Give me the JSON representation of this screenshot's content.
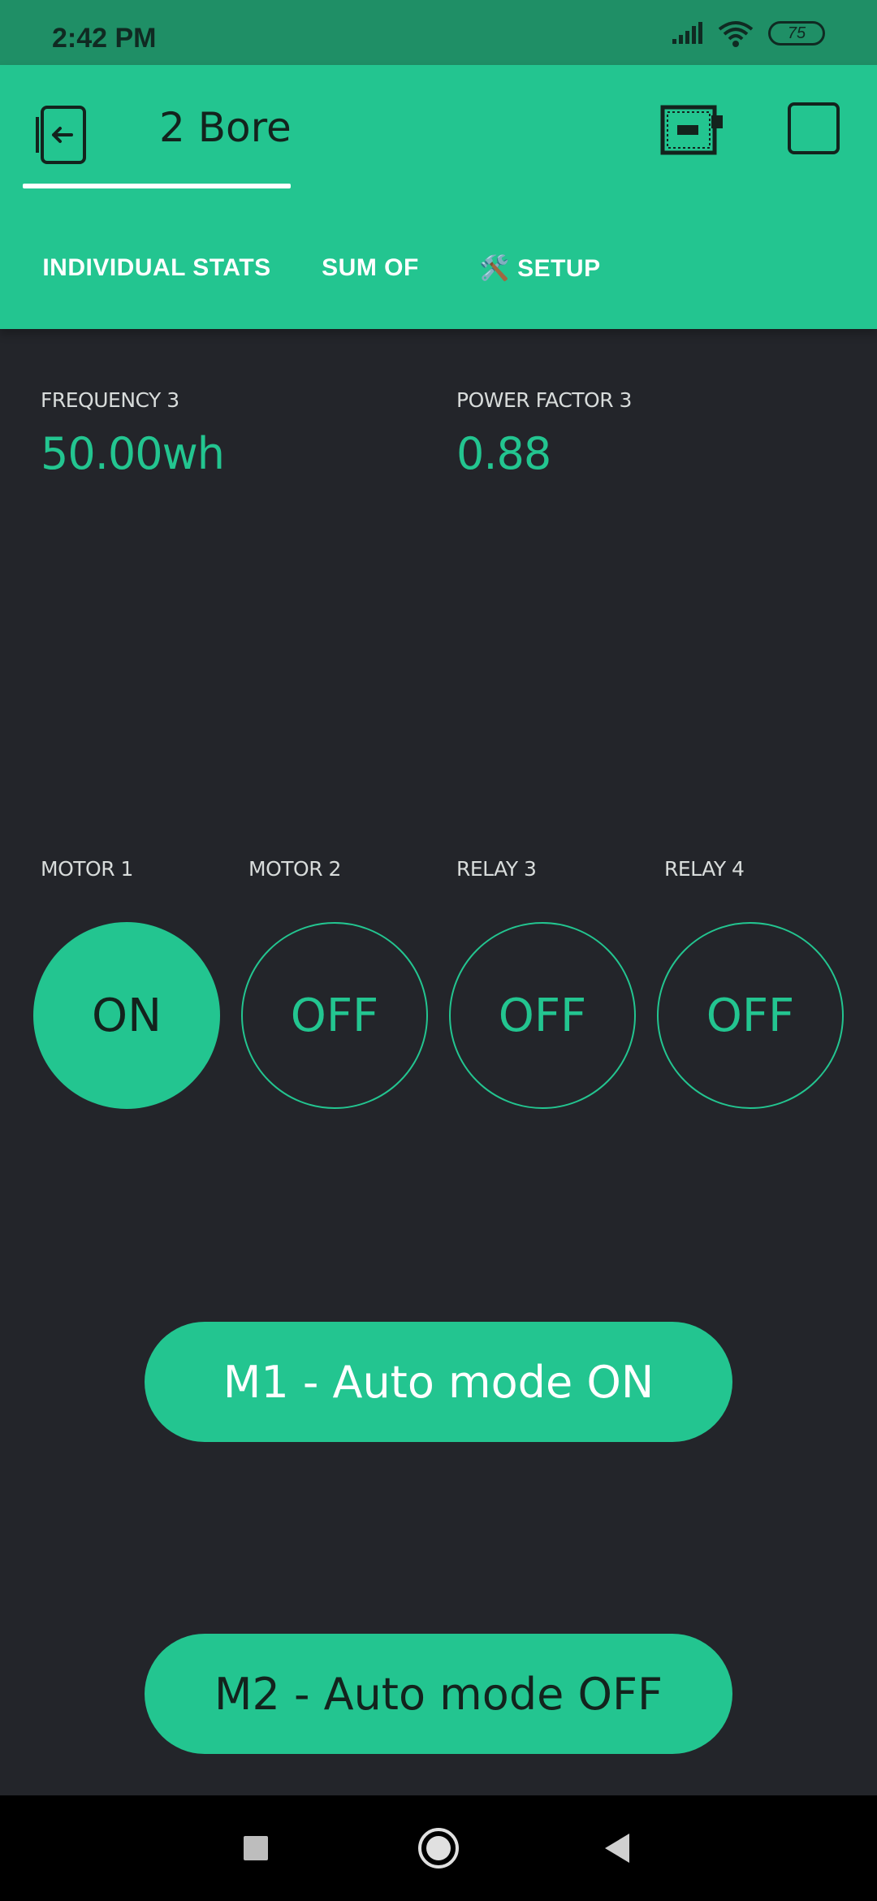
{
  "status_bar": {
    "time": "2:42 PM",
    "battery": "75",
    "icons": [
      "signal-icon",
      "wifi-icon",
      "battery-icon"
    ]
  },
  "header": {
    "title": "2 Bore",
    "icons": [
      "back-icon",
      "device-icon",
      "square-icon"
    ]
  },
  "tabs": [
    {
      "label": "INDIVIDUAL STATS",
      "active": true
    },
    {
      "label": "SUM OF",
      "active": false
    },
    {
      "label": "🛠️ SETUP",
      "active": false
    }
  ],
  "stats": [
    {
      "label": "FREQUENCY 3",
      "value": "50.00wh"
    },
    {
      "label": "POWER FACTOR 3",
      "value": "0.88"
    }
  ],
  "switches": [
    {
      "label": "MOTOR 1",
      "state": "ON"
    },
    {
      "label": "MOTOR 2",
      "state": "OFF"
    },
    {
      "label": "RELAY 3",
      "state": "OFF"
    },
    {
      "label": "RELAY 4",
      "state": "OFF"
    }
  ],
  "buttons": {
    "m1": {
      "label": "M1 - Auto mode ON",
      "text_color": "#ffffff"
    },
    "m2": {
      "label": "M2 - Auto mode OFF",
      "text_color": "#13231d"
    }
  },
  "colors": {
    "accent": "#23c590",
    "background": "#23252a",
    "status_bar": "#1f8f66"
  },
  "nav_bar": {
    "icons": [
      "recents-icon",
      "home-icon",
      "back-nav-icon"
    ]
  }
}
